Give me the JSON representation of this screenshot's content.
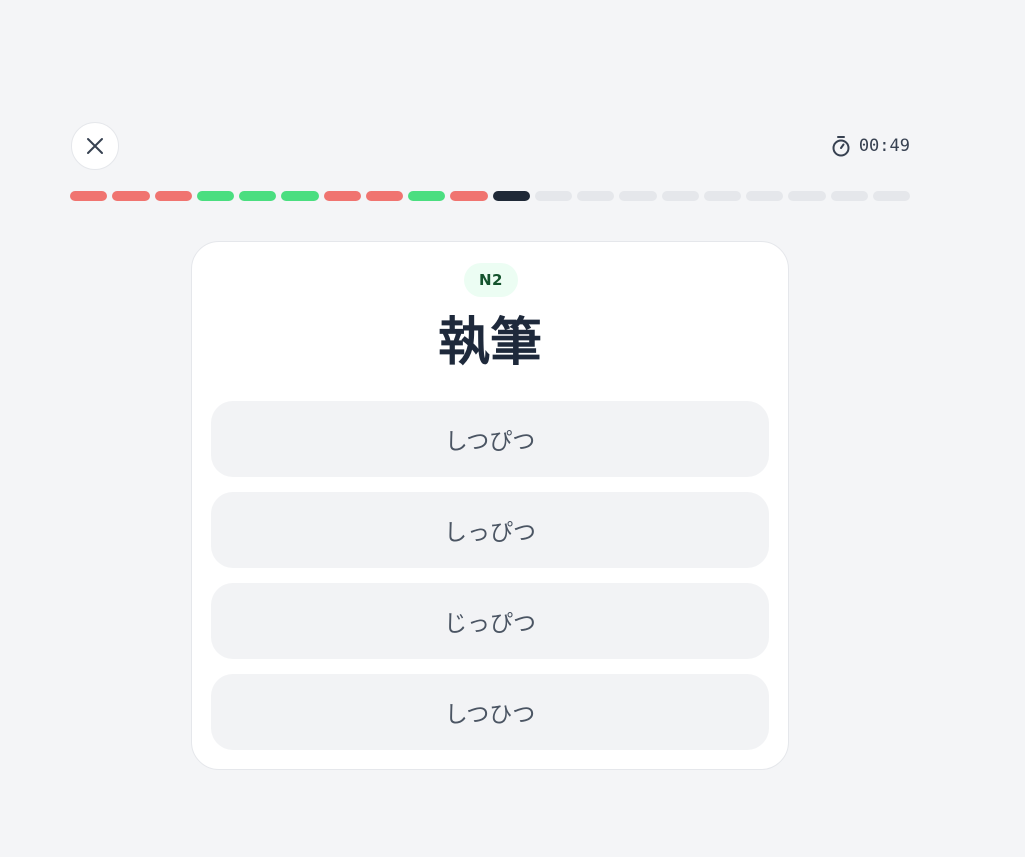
{
  "header": {
    "close_icon": "close-icon",
    "timer_icon": "stopwatch-icon",
    "timer": "00:49"
  },
  "progress": {
    "segments": [
      "wrong",
      "wrong",
      "wrong",
      "correct",
      "correct",
      "correct",
      "wrong",
      "wrong",
      "correct",
      "wrong",
      "current",
      "pending",
      "pending",
      "pending",
      "pending",
      "pending",
      "pending",
      "pending",
      "pending",
      "pending"
    ],
    "current_index": 11,
    "total": 20,
    "colors": {
      "wrong": "#f07470",
      "correct": "#4ade80",
      "current": "#1f2937",
      "pending": "#e5e7eb"
    }
  },
  "question": {
    "level": "N2",
    "kanji": "執筆"
  },
  "options": [
    {
      "label": "しつぴつ"
    },
    {
      "label": "しっぴつ"
    },
    {
      "label": "じっぴつ"
    },
    {
      "label": "しつひつ"
    }
  ]
}
